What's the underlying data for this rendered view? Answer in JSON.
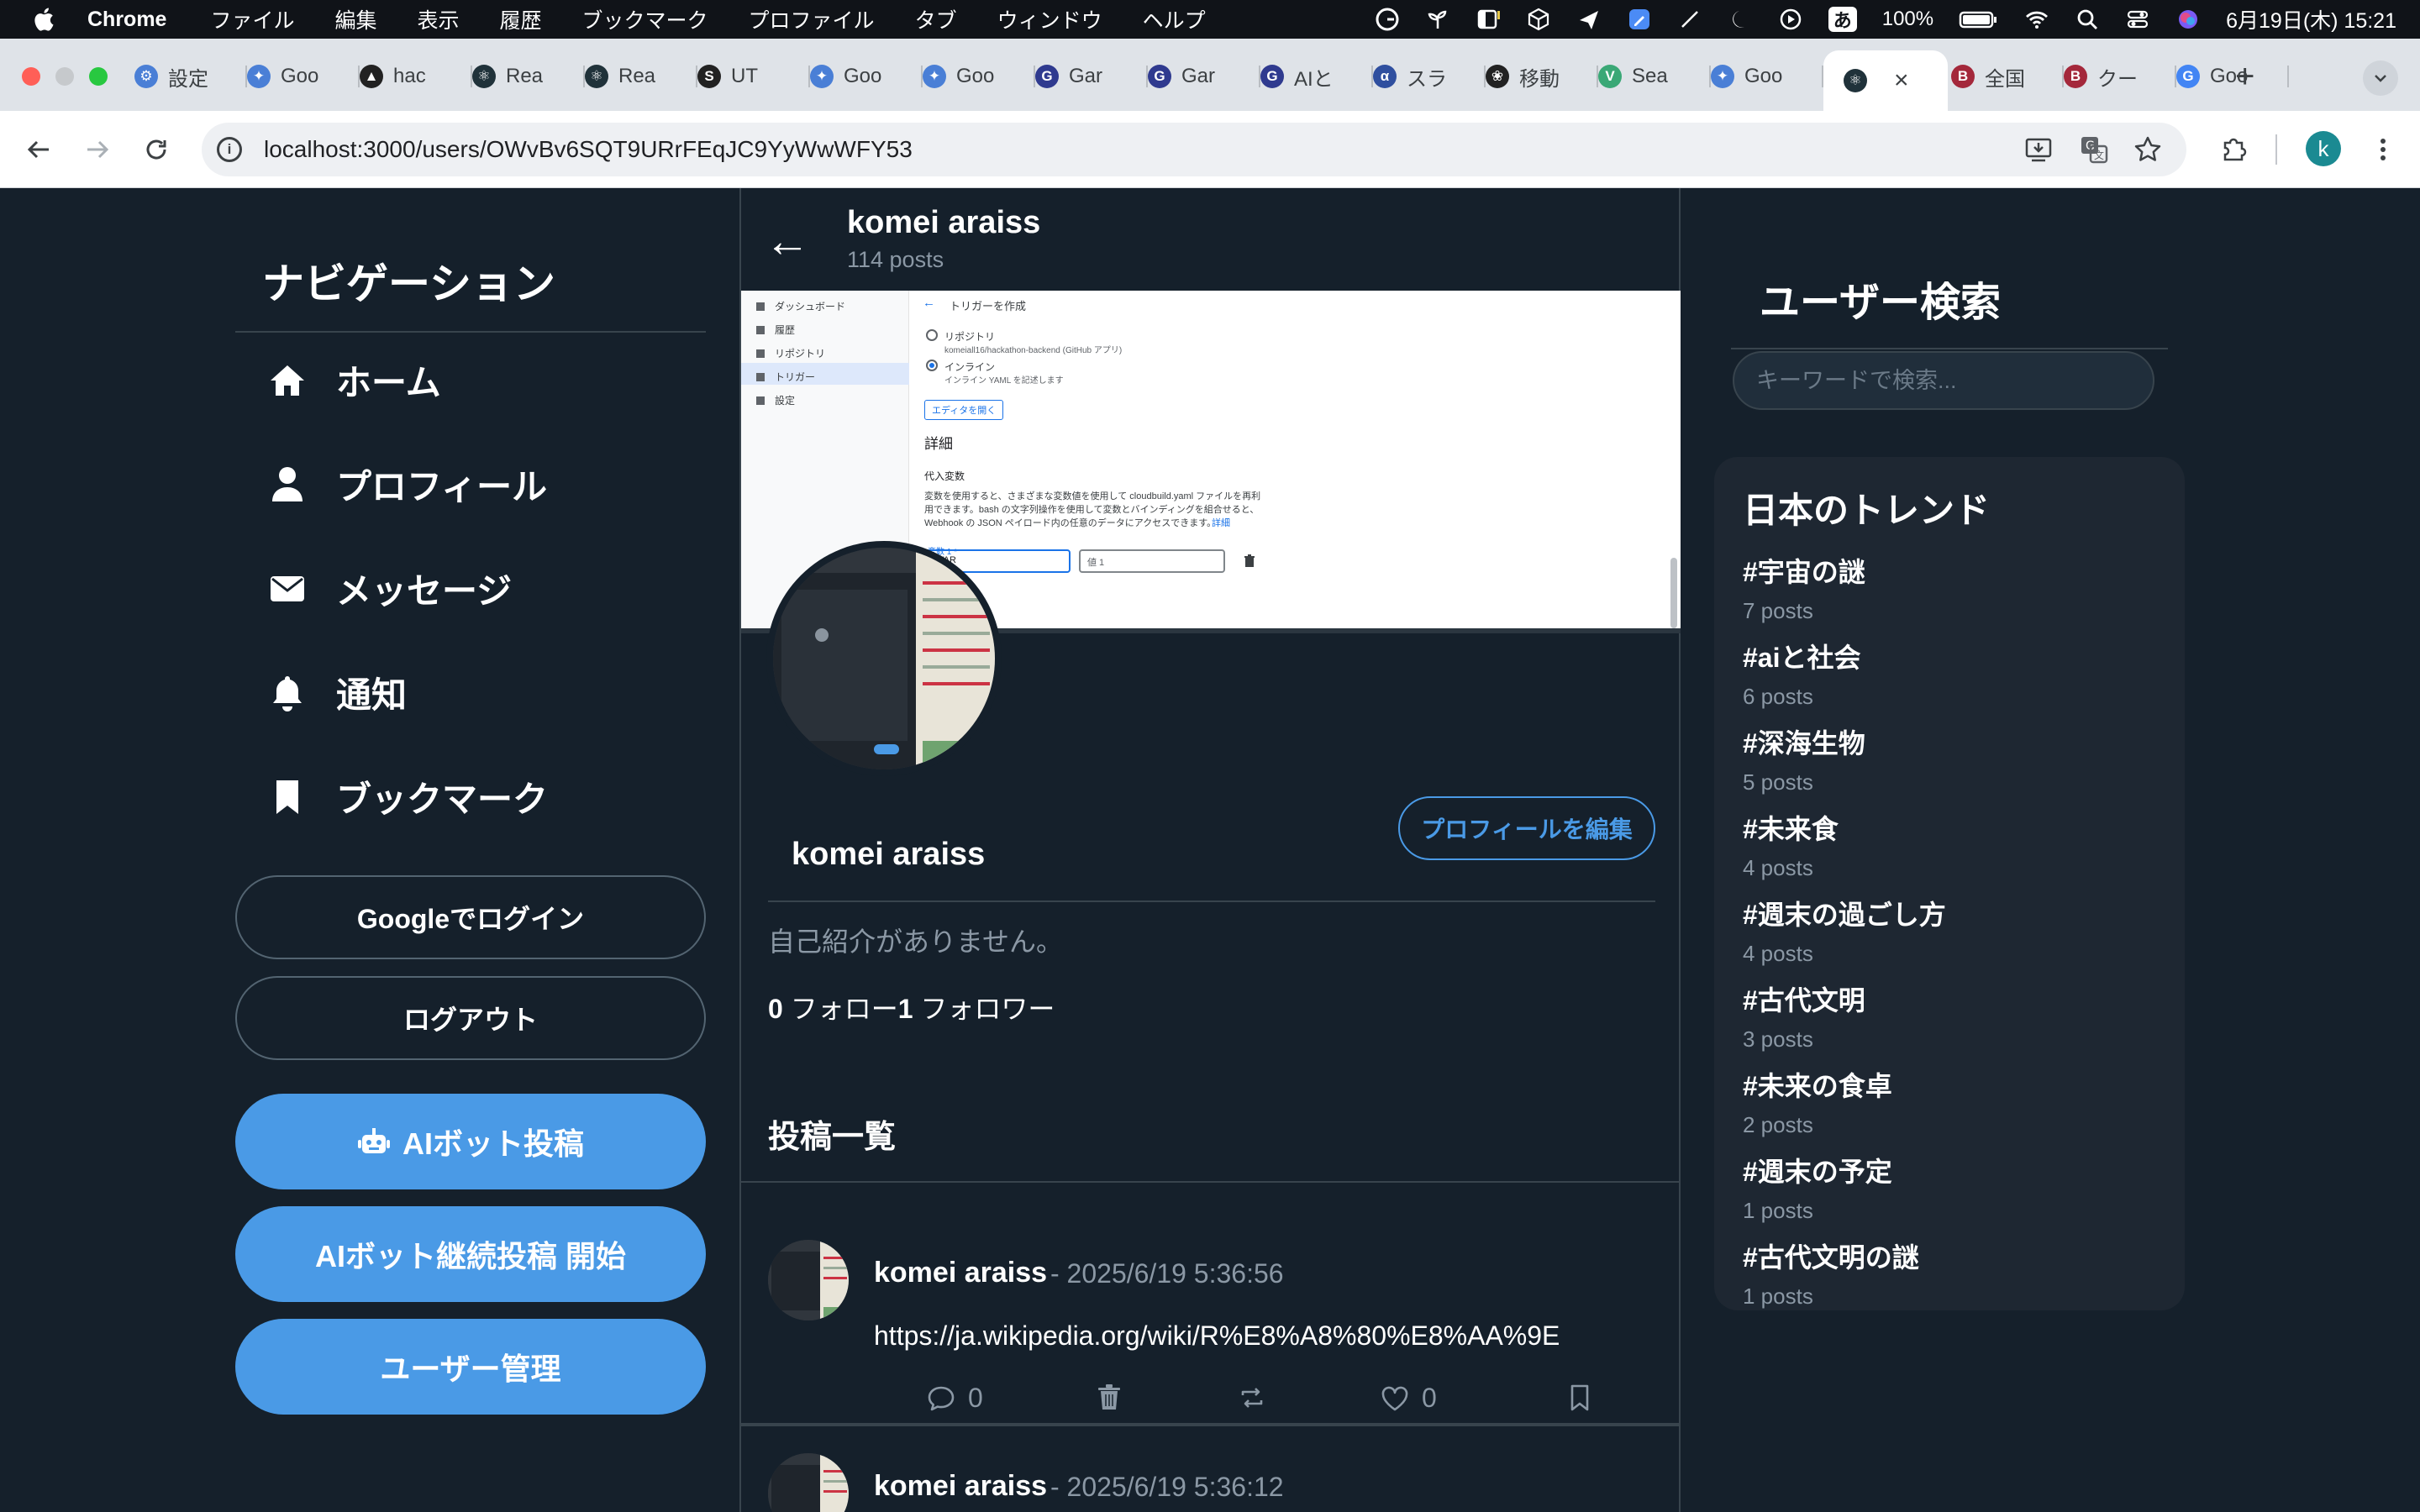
{
  "menubar": {
    "app": "Chrome",
    "items": [
      "ファイル",
      "編集",
      "表示",
      "履歴",
      "ブックマーク",
      "プロファイル",
      "タブ",
      "ウィンドウ",
      "ヘルプ"
    ],
    "battery": "100%",
    "ime": "あ",
    "datetime": "6月19日(木) 15:21"
  },
  "tabs": [
    {
      "label": "設定",
      "icon": "gear-icon",
      "color": "#4a7fd6"
    },
    {
      "label": "Goo",
      "icon": "gemini-icon",
      "color": "#4a7fd6"
    },
    {
      "label": "hac",
      "icon": "triangle-icon",
      "color": "#222222"
    },
    {
      "label": "Rea",
      "icon": "react-icon",
      "color": "#20323a"
    },
    {
      "label": "Rea",
      "icon": "react-icon",
      "color": "#20323a"
    },
    {
      "label": "UT",
      "icon": "swirl-icon",
      "color": "#222222"
    },
    {
      "label": "Goo",
      "icon": "gemini-icon",
      "color": "#4a7fd6"
    },
    {
      "label": "Goo",
      "icon": "gemini-icon",
      "color": "#4a7fd6"
    },
    {
      "label": "Gar",
      "icon": "g-icon",
      "color": "#2f3a8f"
    },
    {
      "label": "Gar",
      "icon": "g-icon",
      "color": "#2f3a8f"
    },
    {
      "label": "AIと",
      "icon": "g-icon",
      "color": "#2f3a8f"
    },
    {
      "label": "スラ",
      "icon": "alpha-icon",
      "color": "#2f4f9f"
    },
    {
      "label": "移動",
      "icon": "openai-icon",
      "color": "#222222"
    },
    {
      "label": "Sea",
      "icon": "vue-icon",
      "color": "#3aa876"
    },
    {
      "label": "Goo",
      "icon": "gemini-icon",
      "color": "#4a7fd6"
    },
    {
      "label": "",
      "icon": "react-icon",
      "color": "#20323a",
      "active": true
    },
    {
      "label": "全国",
      "icon": "b-icon",
      "color": "#a4283b"
    },
    {
      "label": "クー",
      "icon": "b-icon",
      "color": "#a4283b"
    },
    {
      "label": "Goo",
      "icon": "google-icon",
      "color": "#4285f4"
    }
  ],
  "address": {
    "url": "localhost:3000/users/OWvBv6SQT9URrFEqJC9YyWwWFY53",
    "profile_initial": "k"
  },
  "nav": {
    "title": "ナビゲーション",
    "items": [
      {
        "label": "ホーム",
        "icon": "home-icon"
      },
      {
        "label": "プロフィール",
        "icon": "user-icon"
      },
      {
        "label": "メッセージ",
        "icon": "envelope-icon"
      },
      {
        "label": "通知",
        "icon": "bell-icon"
      },
      {
        "label": "ブックマーク",
        "icon": "bookmark-icon"
      }
    ],
    "google_login": "Googleでログイン",
    "logout": "ログアウト",
    "ai_post": "AIボット投稿",
    "ai_continuous": "AIボット継続投稿 開始",
    "user_admin": "ユーザー管理"
  },
  "header": {
    "name": "komei araiss",
    "post_count": "114 posts"
  },
  "banner": {
    "sidebar": [
      "ダッシュボード",
      "履歴",
      "リポジトリ",
      "トリガー",
      "設定"
    ],
    "page_title": "トリガーを作成",
    "opt_repo": "リポジトリ",
    "opt_repo_sub": "komeiall16/hackathon-backend (GitHub アプリ)",
    "opt_inline": "インライン",
    "opt_inline_sub": "インライン YAML を記述します",
    "editor_button": "エディタを開く",
    "section": "詳細",
    "subsection": "代入変数",
    "desc1": "変数を使用すると、さまざまな変数値を使用して cloudbuild.yaml ファイルを再利",
    "desc2": "用できます。bash の文字列操作を使用して変数とバインディングを組合せると、",
    "desc3": "Webhook の JSON ペイロード内の任意のデータにアクセスできます。",
    "desc_link": "詳細",
    "var_label": "変数 1 *",
    "var_value": "_VAR",
    "val_label": "値 1"
  },
  "profile": {
    "edit_button": "プロフィールを編集",
    "name": "komei araiss",
    "bio": "自己紹介がありません。",
    "following_count": "0",
    "following_label": " フォロー",
    "followers_count": "1",
    "followers_label": " フォロワー",
    "posts_title": "投稿一覧"
  },
  "posts": [
    {
      "author": "komei araiss",
      "time": "- 2025/6/19 5:36:56",
      "text": "https://ja.wikipedia.org/wiki/R%E8%A8%80%E8%AA%9E",
      "replies": "0",
      "likes": "0"
    },
    {
      "author": "komei araiss",
      "time": "- 2025/6/19 5:36:12"
    }
  ],
  "search": {
    "title": "ユーザー検索",
    "placeholder": "キーワードで検索..."
  },
  "trends": {
    "title": "日本のトレンド",
    "items": [
      {
        "tag": "#宇宙の謎",
        "count": "7 posts"
      },
      {
        "tag": "#aiと社会",
        "count": "6 posts"
      },
      {
        "tag": "#深海生物",
        "count": "5 posts"
      },
      {
        "tag": "#未来食",
        "count": "4 posts"
      },
      {
        "tag": "#週末の過ごし方",
        "count": "4 posts"
      },
      {
        "tag": "#古代文明",
        "count": "3 posts"
      },
      {
        "tag": "#未来の食卓",
        "count": "2 posts"
      },
      {
        "tag": "#週末の予定",
        "count": "1 posts"
      },
      {
        "tag": "#古代文明の謎",
        "count": "1 posts"
      }
    ]
  },
  "colors": {
    "background": "#15202b",
    "accent": "#4a9ae6",
    "border": "#38444d",
    "muted_text": "#8b98a5",
    "trend_panel": "#1e2732"
  }
}
